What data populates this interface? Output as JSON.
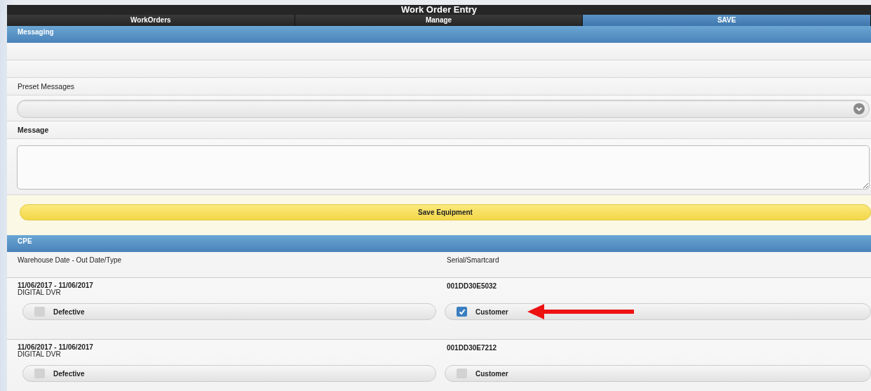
{
  "window": {
    "title": "Work Order Entry"
  },
  "tabs": [
    {
      "label": "WorkOrders",
      "selected": false
    },
    {
      "label": "Manage",
      "selected": false
    },
    {
      "label": "SAVE",
      "selected": true
    }
  ],
  "messaging": {
    "header": "Messaging",
    "preset_label": "Preset Messages",
    "message_label": "Message",
    "save_button": "Save Equipment"
  },
  "cpe": {
    "header": "CPE",
    "columns": [
      "Warehouse Date - Out Date/Type",
      "Serial/Smartcard"
    ],
    "items": [
      {
        "dates": "11/06/2017 - 11/06/2017",
        "type": "DIGITAL DVR",
        "serial": "001DD30E5032",
        "defective": {
          "label": "Defective",
          "checked": false
        },
        "customer": {
          "label": "Customer",
          "checked": true
        },
        "annotated": true
      },
      {
        "dates": "11/06/2017 - 11/06/2017",
        "type": "DIGITAL DVR",
        "serial": "001DD30E7212",
        "defective": {
          "label": "Defective",
          "checked": false
        },
        "customer": {
          "label": "Customer",
          "checked": false
        },
        "annotated": false
      }
    ]
  }
}
